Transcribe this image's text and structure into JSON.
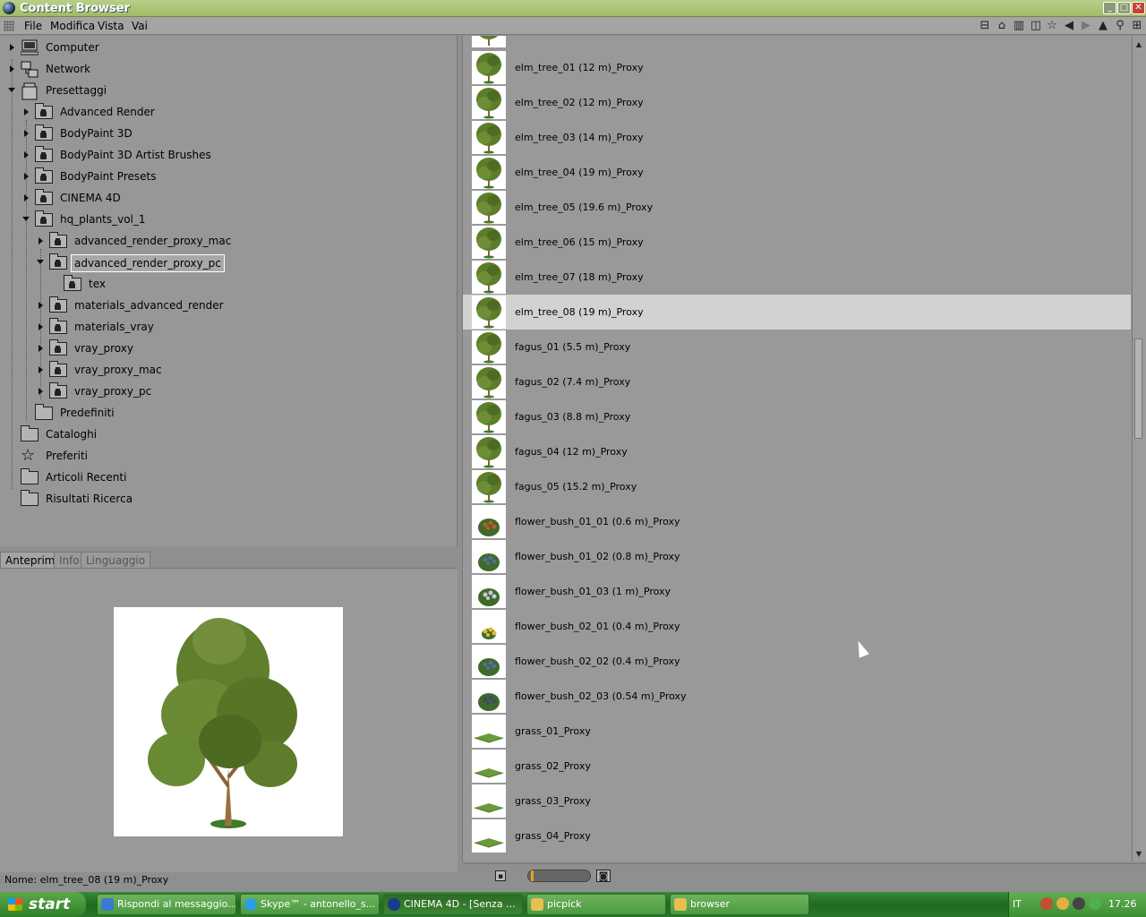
{
  "window": {
    "title": "Content Browser"
  },
  "menu": [
    "File",
    "Modifica",
    "Vista",
    "Vai"
  ],
  "toolbar_icons": [
    "view-mode-icon",
    "home-icon",
    "preset-icon",
    "catalog-icon",
    "star-icon",
    "back-icon",
    "forward-icon",
    "up-icon",
    "search-icon",
    "add-icon"
  ],
  "tree": [
    {
      "label": "Computer",
      "icon": "computer-icon"
    },
    {
      "label": "Network",
      "icon": "network-icon"
    },
    {
      "label": "Presettaggi",
      "icon": "preset-jar-icon"
    },
    {
      "label": "Advanced Render",
      "icon": "locked-folder-icon"
    },
    {
      "label": "BodyPaint 3D",
      "icon": "locked-folder-icon"
    },
    {
      "label": "BodyPaint 3D Artist Brushes",
      "icon": "locked-folder-icon"
    },
    {
      "label": "BodyPaint Presets",
      "icon": "locked-folder-icon"
    },
    {
      "label": "CINEMA 4D",
      "icon": "locked-folder-icon"
    },
    {
      "label": "hq_plants_vol_1",
      "icon": "open-locked-folder-icon"
    },
    {
      "label": "advanced_render_proxy_mac",
      "icon": "locked-folder-icon"
    },
    {
      "label": "advanced_render_proxy_pc",
      "icon": "open-locked-folder-icon"
    },
    {
      "label": "tex",
      "icon": "locked-folder-icon"
    },
    {
      "label": "materials_advanced_render",
      "icon": "locked-folder-icon"
    },
    {
      "label": "materials_vray",
      "icon": "locked-folder-icon"
    },
    {
      "label": "vray_proxy",
      "icon": "locked-folder-icon"
    },
    {
      "label": "vray_proxy_mac",
      "icon": "locked-folder-icon"
    },
    {
      "label": "vray_proxy_pc",
      "icon": "locked-folder-icon"
    },
    {
      "label": "Predefiniti",
      "icon": "folder-icon"
    },
    {
      "label": "Cataloghi",
      "icon": "catalog-icon"
    },
    {
      "label": "Preferiti",
      "icon": "star-icon"
    },
    {
      "label": "Articoli Recenti",
      "icon": "folder-icon"
    },
    {
      "label": "Risultati Ricerca",
      "icon": "search-folder-icon"
    }
  ],
  "tabs": [
    "Anteprima",
    "Info",
    "Linguaggio"
  ],
  "preview": {
    "name_label": "Nome:",
    "name_value": "elm_tree_08 (19 m)_Proxy"
  },
  "items": [
    {
      "label": "elm_tree_01 (12 m)_Proxy",
      "kind": "tree"
    },
    {
      "label": "elm_tree_02 (12 m)_Proxy",
      "kind": "tree"
    },
    {
      "label": "elm_tree_03 (14 m)_Proxy",
      "kind": "tree"
    },
    {
      "label": "elm_tree_04 (19 m)_Proxy",
      "kind": "tree"
    },
    {
      "label": "elm_tree_05 (19.6 m)_Proxy",
      "kind": "tree"
    },
    {
      "label": "elm_tree_06 (15 m)_Proxy",
      "kind": "tree"
    },
    {
      "label": "elm_tree_07 (18 m)_Proxy",
      "kind": "tree"
    },
    {
      "label": "elm_tree_08 (19 m)_Proxy",
      "kind": "tree"
    },
    {
      "label": "fagus_01 (5.5 m)_Proxy",
      "kind": "tree"
    },
    {
      "label": "fagus_02 (7.4 m)_Proxy",
      "kind": "tree"
    },
    {
      "label": "fagus_03 (8.8 m)_Proxy",
      "kind": "tree"
    },
    {
      "label": "fagus_04 (12 m)_Proxy",
      "kind": "tree"
    },
    {
      "label": "fagus_05 (15.2 m)_Proxy",
      "kind": "tree"
    },
    {
      "label": "flower_bush_01_01 (0.6 m)_Proxy",
      "kind": "bush-red"
    },
    {
      "label": "flower_bush_01_02 (0.8 m)_Proxy",
      "kind": "bush-blue"
    },
    {
      "label": "flower_bush_01_03 (1 m)_Proxy",
      "kind": "bush-white"
    },
    {
      "label": "flower_bush_02_01 (0.4 m)_Proxy",
      "kind": "bush-yellow"
    },
    {
      "label": "flower_bush_02_02 (0.4 m)_Proxy",
      "kind": "bush-blue"
    },
    {
      "label": "flower_bush_02_03 (0.54 m)_Proxy",
      "kind": "bush-dark"
    },
    {
      "label": "grass_01_Proxy",
      "kind": "grass"
    },
    {
      "label": "grass_02_Proxy",
      "kind": "grass"
    },
    {
      "label": "grass_03_Proxy",
      "kind": "grass"
    },
    {
      "label": "grass_04_Proxy",
      "kind": "grass"
    }
  ],
  "selected_index": 7,
  "taskbar": {
    "start": "start",
    "tasks": [
      "Rispondi al messaggio...",
      "Skype™ - antonello_s...",
      "CINEMA 4D - [Senza ...",
      "picpick",
      "browser"
    ],
    "active_task": 2,
    "language": "IT",
    "clock": "17.26"
  },
  "colors": {
    "selection": "#d2d2d2",
    "title_green": "#9fbb66",
    "taskbar_green": "#2a762a"
  }
}
